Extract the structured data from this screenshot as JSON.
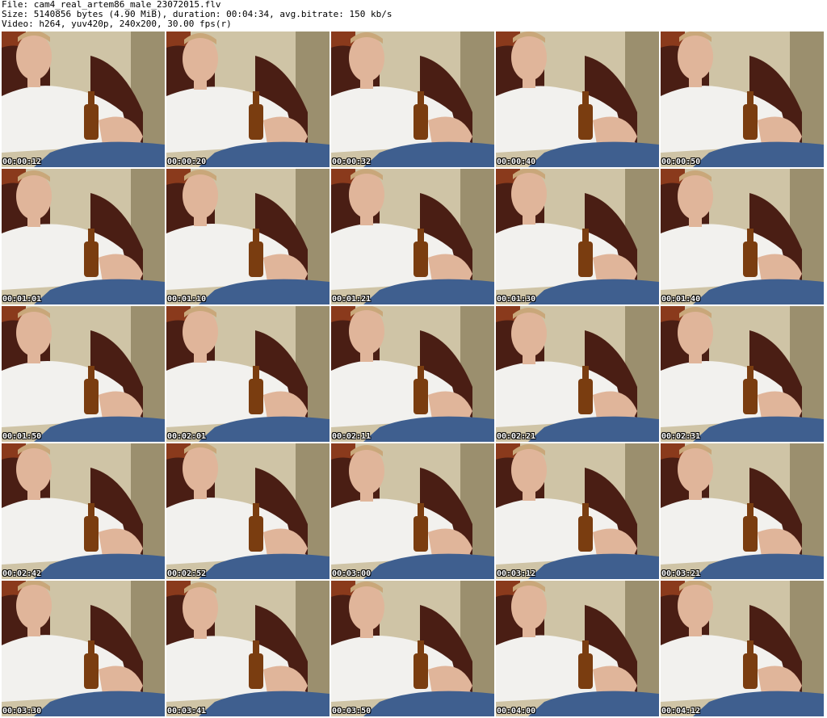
{
  "header": {
    "file_line": "File: cam4_real_artem86_male_23072015.flv",
    "size_line": "Size: 5140856 bytes (4.90 MiB), duration: 00:04:34, avg.bitrate: 150 kb/s",
    "video_line": "Video: h264, yuv420p, 240x200, 30.00 fps(r)"
  },
  "thumbnails": [
    {
      "timestamp": "00:00:12"
    },
    {
      "timestamp": "00:00:20"
    },
    {
      "timestamp": "00:00:32"
    },
    {
      "timestamp": "00:00:40"
    },
    {
      "timestamp": "00:00:50"
    },
    {
      "timestamp": "00:01:01"
    },
    {
      "timestamp": "00:01:10"
    },
    {
      "timestamp": "00:01:21"
    },
    {
      "timestamp": "00:01:30"
    },
    {
      "timestamp": "00:01:40"
    },
    {
      "timestamp": "00:01:50"
    },
    {
      "timestamp": "00:02:01"
    },
    {
      "timestamp": "00:02:11"
    },
    {
      "timestamp": "00:02:21"
    },
    {
      "timestamp": "00:02:31"
    },
    {
      "timestamp": "00:02:42"
    },
    {
      "timestamp": "00:02:52"
    },
    {
      "timestamp": "00:03:00"
    },
    {
      "timestamp": "00:03:12"
    },
    {
      "timestamp": "00:03:21"
    },
    {
      "timestamp": "00:03:30"
    },
    {
      "timestamp": "00:03:41"
    },
    {
      "timestamp": "00:03:50"
    },
    {
      "timestamp": "00:04:00"
    },
    {
      "timestamp": "00:04:12"
    }
  ],
  "colors": {
    "wall": "#cfc4a6",
    "wall_shadow": "#9b8f6e",
    "chair": "#4a1e14",
    "curtain": "#8a3a1c",
    "shirt": "#f2f1ee",
    "skin": "#e0b59a",
    "bottle": "#7a3d10",
    "jeans": "#3f5f8f"
  }
}
